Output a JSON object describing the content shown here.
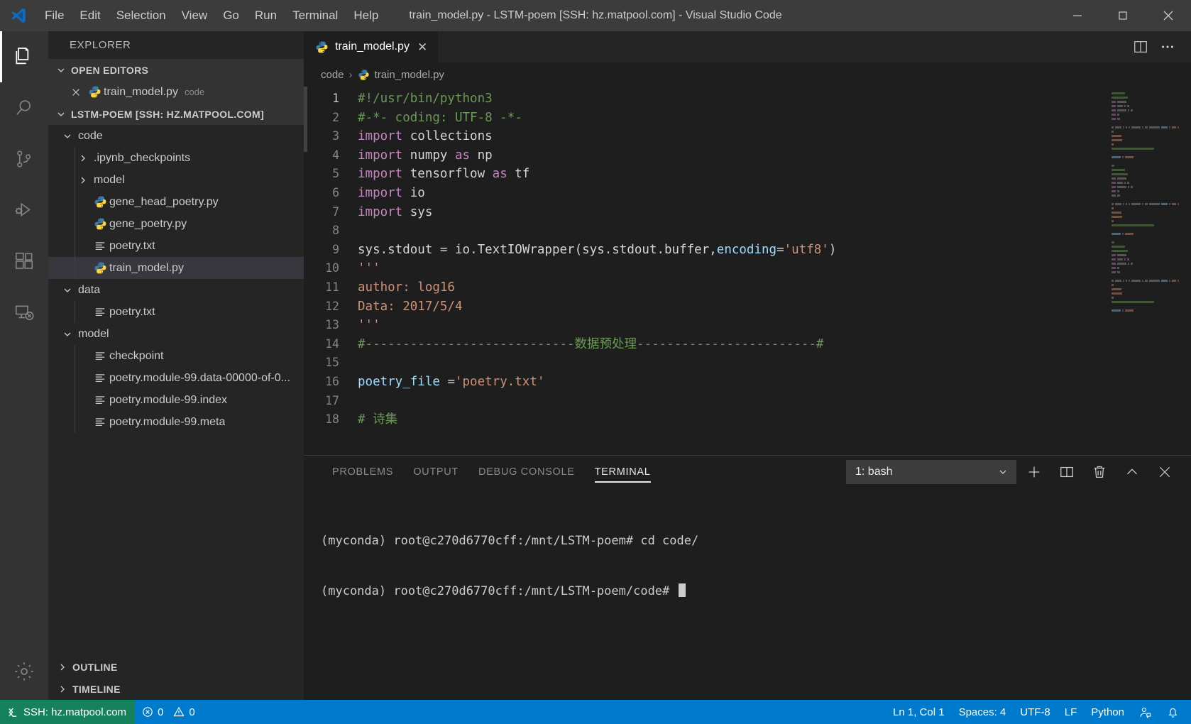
{
  "window": {
    "title": "train_model.py - LSTM-poem [SSH: hz.matpool.com] - Visual Studio Code",
    "minimize_label": "─",
    "maximize_label": "☐",
    "close_label": "✕"
  },
  "menubar": {
    "items": [
      "File",
      "Edit",
      "Selection",
      "View",
      "Go",
      "Run",
      "Terminal",
      "Help"
    ]
  },
  "activitybar": {
    "items": [
      {
        "name": "explorer-icon",
        "active": true
      },
      {
        "name": "search-icon",
        "active": false
      },
      {
        "name": "source-control-icon",
        "active": false
      },
      {
        "name": "run-and-debug-icon",
        "active": false
      },
      {
        "name": "extensions-icon",
        "active": false
      },
      {
        "name": "remote-explorer-icon",
        "active": false
      }
    ],
    "settings_label": "gear-icon"
  },
  "sidebar": {
    "title": "EXPLORER",
    "open_editors": {
      "label": "OPEN EDITORS",
      "items": [
        {
          "name": "train_model.py",
          "description": "code",
          "icon": "python-file-icon"
        }
      ]
    },
    "workspace": {
      "label": "LSTM-POEM [SSH: HZ.MATPOOL.COM]",
      "tree": [
        {
          "label": "code",
          "type": "folder",
          "expanded": true,
          "depth": 1,
          "icon": "chevron-down-icon"
        },
        {
          "label": ".ipynb_checkpoints",
          "type": "folder",
          "expanded": false,
          "depth": 2,
          "icon": "chevron-right-icon"
        },
        {
          "label": "model",
          "type": "folder",
          "expanded": false,
          "depth": 2,
          "icon": "chevron-right-icon"
        },
        {
          "label": "gene_head_poetry.py",
          "type": "python",
          "depth": 2,
          "icon": "python-file-icon"
        },
        {
          "label": "gene_poetry.py",
          "type": "python",
          "depth": 2,
          "icon": "python-file-icon"
        },
        {
          "label": "poetry.txt",
          "type": "text",
          "depth": 2,
          "icon": "text-file-icon"
        },
        {
          "label": "train_model.py",
          "type": "python",
          "depth": 2,
          "icon": "python-file-icon",
          "selected": true
        },
        {
          "label": "data",
          "type": "folder",
          "expanded": true,
          "depth": 1,
          "icon": "chevron-down-icon"
        },
        {
          "label": "poetry.txt",
          "type": "text",
          "depth": 2,
          "icon": "text-file-icon"
        },
        {
          "label": "model",
          "type": "folder",
          "expanded": true,
          "depth": 1,
          "icon": "chevron-down-icon"
        },
        {
          "label": "checkpoint",
          "type": "text",
          "depth": 2,
          "icon": "text-file-icon"
        },
        {
          "label": "poetry.module-99.data-00000-of-0...",
          "type": "text",
          "depth": 2,
          "icon": "text-file-icon"
        },
        {
          "label": "poetry.module-99.index",
          "type": "text",
          "depth": 2,
          "icon": "text-file-icon"
        },
        {
          "label": "poetry.module-99.meta",
          "type": "text",
          "depth": 2,
          "icon": "text-file-icon"
        }
      ]
    },
    "outline_label": "OUTLINE",
    "timeline_label": "TIMELINE"
  },
  "editor": {
    "tab": {
      "label": "train_model.py",
      "icon": "python-file-icon",
      "close": "✕"
    },
    "actions": {
      "split_editor": "split-editor-icon",
      "more_actions": "more-actions-icon"
    },
    "breadcrumb": [
      "code",
      "train_model.py"
    ],
    "breadcrumb_separator": "›",
    "lines": [
      {
        "n": 1,
        "tokens": [
          {
            "t": "#!/usr/bin/python3",
            "c": "cm"
          }
        ]
      },
      {
        "n": 2,
        "tokens": [
          {
            "t": "#-*- coding: UTF-8 -*-",
            "c": "cm"
          }
        ]
      },
      {
        "n": 3,
        "tokens": [
          {
            "t": "import",
            "c": "k"
          },
          {
            "t": " collections",
            "c": "ctext"
          }
        ]
      },
      {
        "n": 4,
        "tokens": [
          {
            "t": "import",
            "c": "k"
          },
          {
            "t": " numpy ",
            "c": "ctext"
          },
          {
            "t": "as",
            "c": "k"
          },
          {
            "t": " np",
            "c": "ctext"
          }
        ]
      },
      {
        "n": 5,
        "tokens": [
          {
            "t": "import",
            "c": "k"
          },
          {
            "t": " tensorflow ",
            "c": "ctext"
          },
          {
            "t": "as",
            "c": "k"
          },
          {
            "t": " tf",
            "c": "ctext"
          }
        ]
      },
      {
        "n": 6,
        "tokens": [
          {
            "t": "import",
            "c": "k"
          },
          {
            "t": " io",
            "c": "ctext"
          }
        ]
      },
      {
        "n": 7,
        "tokens": [
          {
            "t": "import",
            "c": "k"
          },
          {
            "t": " sys",
            "c": "ctext"
          }
        ]
      },
      {
        "n": 8,
        "tokens": []
      },
      {
        "n": 9,
        "tokens": [
          {
            "t": "sys",
            "c": "ctext"
          },
          {
            "t": ".stdout ",
            "c": "ctext"
          },
          {
            "t": "= ",
            "c": "op"
          },
          {
            "t": "io",
            "c": "ctext"
          },
          {
            "t": ".",
            "c": "op"
          },
          {
            "t": "TextIOWrapper",
            "c": "ctext"
          },
          {
            "t": "(",
            "c": "op"
          },
          {
            "t": "sys",
            "c": "ctext"
          },
          {
            "t": ".stdout.buffer,",
            "c": "ctext"
          },
          {
            "t": "encoding",
            "c": "vr"
          },
          {
            "t": "=",
            "c": "op"
          },
          {
            "t": "'utf8'",
            "c": "st"
          },
          {
            "t": ")",
            "c": "op"
          }
        ]
      },
      {
        "n": 10,
        "tokens": [
          {
            "t": "'''",
            "c": "st"
          }
        ]
      },
      {
        "n": 11,
        "tokens": [
          {
            "t": "author: log16",
            "c": "st"
          }
        ]
      },
      {
        "n": 12,
        "tokens": [
          {
            "t": "Data: 2017/5/4",
            "c": "st"
          }
        ]
      },
      {
        "n": 13,
        "tokens": [
          {
            "t": "'''",
            "c": "st"
          }
        ]
      },
      {
        "n": 14,
        "tokens": [
          {
            "t": "#----------------------------数据预处理------------------------#",
            "c": "cm"
          }
        ]
      },
      {
        "n": 15,
        "tokens": []
      },
      {
        "n": 16,
        "tokens": [
          {
            "t": "poetry_file ",
            "c": "vr"
          },
          {
            "t": "=",
            "c": "op"
          },
          {
            "t": "'poetry.txt'",
            "c": "st"
          }
        ]
      },
      {
        "n": 17,
        "tokens": []
      },
      {
        "n": 18,
        "tokens": [
          {
            "t": "# 诗集",
            "c": "cm"
          }
        ]
      }
    ]
  },
  "panel": {
    "tabs": [
      {
        "label": "PROBLEMS",
        "active": false
      },
      {
        "label": "OUTPUT",
        "active": false
      },
      {
        "label": "DEBUG CONSOLE",
        "active": false
      },
      {
        "label": "TERMINAL",
        "active": true
      }
    ],
    "terminal_select": {
      "value": "1: bash",
      "chevron": "chevron-down-icon"
    },
    "actions": {
      "new_terminal": "plus-icon",
      "split_terminal": "split-icon",
      "kill_terminal": "trash-icon",
      "maximize_panel": "chevron-up-icon",
      "close_panel": "close-icon"
    },
    "terminal_lines": [
      "(myconda) root@c270d6770cff:/mnt/LSTM-poem# cd code/",
      "(myconda) root@c270d6770cff:/mnt/LSTM-poem/code# "
    ]
  },
  "statusbar": {
    "remote": {
      "label": "SSH: hz.matpool.com",
      "icon": "remote-icon"
    },
    "problems": {
      "errors": "0",
      "warnings": "0",
      "error_icon": "error-circle-icon",
      "warning_icon": "warning-triangle-icon"
    },
    "right_items": [
      {
        "name": "editor-position",
        "label": "Ln 1, Col 1"
      },
      {
        "name": "indentation",
        "label": "Spaces: 4"
      },
      {
        "name": "encoding",
        "label": "UTF-8"
      },
      {
        "name": "eol",
        "label": "LF"
      },
      {
        "name": "language-mode",
        "label": "Python"
      }
    ],
    "feedback_icon": "account-icon",
    "notifications_icon": "bell-icon"
  },
  "colors": {
    "accent": "#007acc",
    "remote_green": "#16825d",
    "titlebar": "#3c3c3c",
    "sidebar": "#252526",
    "editor_bg": "#1e1e1e",
    "comment_green": "#6a9955",
    "string_orange": "#ce9178",
    "keyword_magenta": "#c586c0"
  }
}
